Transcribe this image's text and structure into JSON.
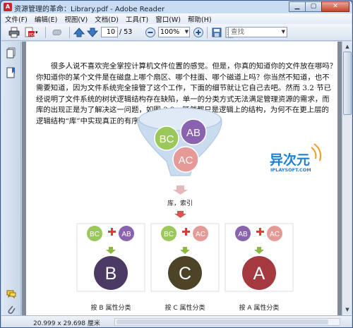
{
  "window": {
    "title": "资源管理的革命：Library.pdf - Adobe Reader",
    "app_icon": "adobe-reader-icon",
    "controls": [
      "minimize",
      "maximize",
      "close"
    ]
  },
  "menu": [
    "文件(F)",
    "编辑(E)",
    "视图(V)",
    "文档(D)",
    "工具(T)",
    "窗口(W)",
    "帮助(H)"
  ],
  "toolbar": {
    "page_current": "10",
    "page_total": "/ 53",
    "zoom": "100%",
    "search_placeholder": "查找",
    "icons": [
      "print-icon",
      "pdf-export-icon",
      "hand-tool-icon",
      "page-up-icon",
      "page-down-icon",
      "zoom-out-icon",
      "zoom-in-icon",
      "save-icon",
      "fit-width-icon"
    ]
  },
  "document": {
    "paragraph_lines": [
      "很多人说不喜欢完全掌控计算机文件位置的感觉。但是，你真的知道你的文件放在哪吗？",
      "你知道你的某个文件是在磁盘上哪个扇区、哪个柱面、哪个磁道上吗？你当然不知道，也不",
      "需要知道，因为文件系统完全接管了这个工作，下面的细节就让它自己去吧。然而 3.2 节已",
      "经说明了文件系统的树状逻辑结构存在缺陷，单一的分类方式无法满足管理资源的需求，而",
      "库的出现正是为了解决这一问题，如图 3-2。既然都只是逻辑上的结构，为何不在更上层的",
      "逻辑结构“库”中实现真正的有序呢？"
    ],
    "funnel": {
      "circles": [
        "BC",
        "AB",
        "AC"
      ],
      "label": "库，索引"
    },
    "groups": [
      {
        "inputs": [
          "BC",
          "AB"
        ],
        "result": "B",
        "caption": "按 B 属性分类"
      },
      {
        "inputs": [
          "BC",
          "AC"
        ],
        "result": "C",
        "caption": "按 C 属性分类"
      },
      {
        "inputs": [
          "AB",
          "AC"
        ],
        "result": "A",
        "caption": "按 A 属性分类"
      }
    ],
    "watermark": {
      "text": "异次元",
      "subtext": "IPLAYSOFT.COM"
    }
  },
  "colors": {
    "bc": "#9bc85a",
    "ab": "#8a63b0",
    "ac": "#e59a98",
    "b_dark": "#4b3a63",
    "c_dark": "#4d4428",
    "a_dark": "#a43a3f",
    "plus": "#e03a3f",
    "arrow": "#8bb840",
    "funnel": "#c9dbee"
  },
  "statusbar": {
    "page_size": "20.999 x 29.698 厘米"
  },
  "leftnav": [
    "pages-icon",
    "bookmarks-icon",
    "comments-icon",
    "attachments-icon"
  ]
}
